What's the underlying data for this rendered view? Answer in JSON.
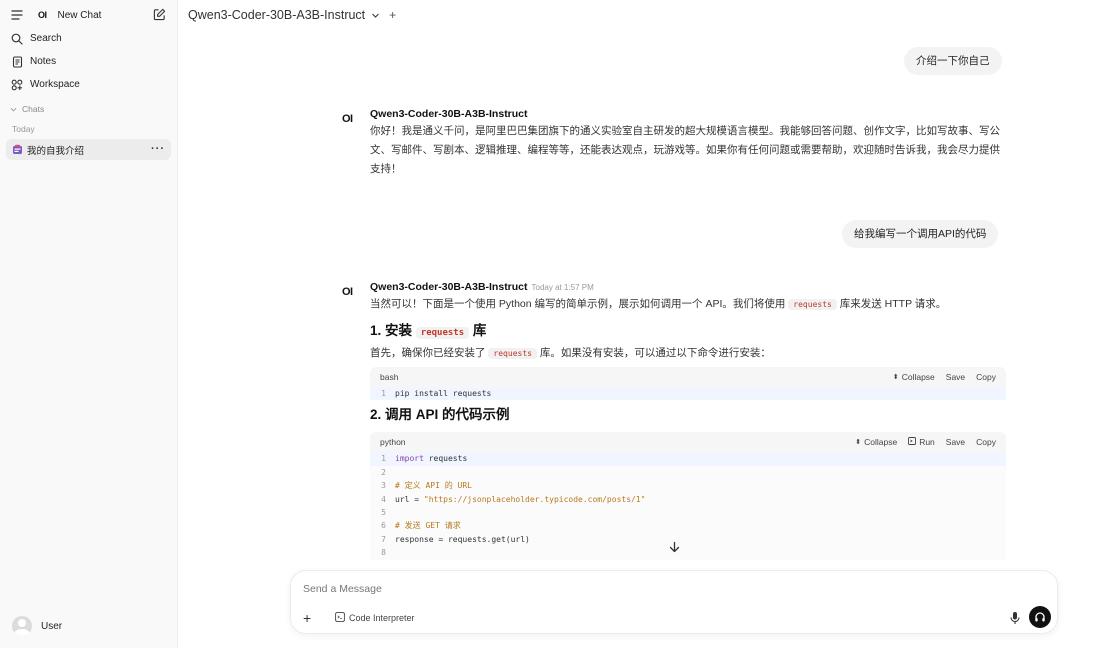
{
  "sidebar": {
    "logo": "OI",
    "new_chat": "New Chat",
    "items": [
      {
        "label": "Search",
        "icon": "search-icon"
      },
      {
        "label": "Notes",
        "icon": "notes-icon"
      },
      {
        "label": "Workspace",
        "icon": "workspace-icon"
      }
    ],
    "chats_label": "Chats",
    "today_label": "Today",
    "chat_item": "我的自我介绍",
    "user": "User"
  },
  "topbar": {
    "model": "Qwen3-Coder-30B-A3B-Instruct"
  },
  "messages": {
    "user1": "介绍一下你自己",
    "assistant1": {
      "logo": "OI",
      "name": "Qwen3-Coder-30B-A3B-Instruct",
      "text": "你好！我是通义千问，是阿里巴巴集团旗下的通义实验室自主研发的超大规模语言模型。我能够回答问题、创作文字，比如写故事、写公文、写邮件、写剧本、逻辑推理、编程等等，还能表达观点，玩游戏等。如果你有任何问题或需要帮助，欢迎随时告诉我，我会尽力提供支持！"
    },
    "user2": "给我编写一个调用API的代码",
    "assistant2": {
      "logo": "OI",
      "name": "Qwen3-Coder-30B-A3B-Instruct",
      "time": "Today at 1:57 PM",
      "intro_a": "当然可以！下面是一个使用 Python 编写的简单示例，展示如何调用一个 API。我们将使用",
      "intro_code": "requests",
      "intro_b": "库来发送 HTTP 请求。",
      "h1_a": "1. 安装",
      "h1_code": "requests",
      "h1_b": "库",
      "p1_a": "首先，确保你已经安装了",
      "p1_code": "requests",
      "p1_b": "库。如果没有安装，可以通过以下命令进行安装：",
      "code1": {
        "lang": "bash",
        "collapse": "Collapse",
        "save": "Save",
        "copy": "Copy",
        "lines": [
          "pip install requests"
        ]
      },
      "h2": "2. 调用 API 的代码示例",
      "code2": {
        "lang": "python",
        "collapse": "Collapse",
        "run": "Run",
        "save": "Save",
        "copy": "Copy",
        "l1_kw": "import",
        "l1_rest": " requests",
        "l3": "# 定义 API 的 URL",
        "l4_a": "url = ",
        "l4_str": "\"https://jsonplaceholder.typicode.com/posts/1\"",
        "l6": "# 发送 GET 请求",
        "l7": "response = requests.get(url)"
      }
    }
  },
  "input": {
    "placeholder": "Send a Message",
    "code_interpreter": "Code Interpreter"
  }
}
